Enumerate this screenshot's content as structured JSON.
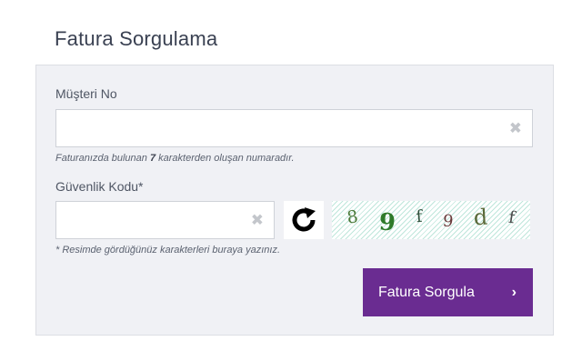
{
  "page": {
    "title": "Fatura Sorgulama"
  },
  "form": {
    "customer_no": {
      "label": "Müşteri No",
      "value": "",
      "hint_prefix": "Faturanızda bulunan ",
      "hint_bold": "7",
      "hint_suffix": " karakterden oluşan numaradır.",
      "clear_icon": "✖"
    },
    "security_code": {
      "label": "Güvenlik Kodu*",
      "value": "",
      "hint": "* Resimde gördüğünüz karakterleri buraya yazınız.",
      "clear_icon": "✖"
    },
    "captcha": {
      "chars": [
        "8",
        "9",
        "f",
        "9",
        "d",
        "f"
      ],
      "colors": [
        "#4b7a3a",
        "#2f7a2a",
        "#2f4f3a",
        "#6a3a3a",
        "#5a6a3a",
        "#4a4a4a"
      ]
    },
    "submit": {
      "label": "Fatura Sorgula",
      "chevron": "›",
      "color": "#6a2c91"
    }
  }
}
